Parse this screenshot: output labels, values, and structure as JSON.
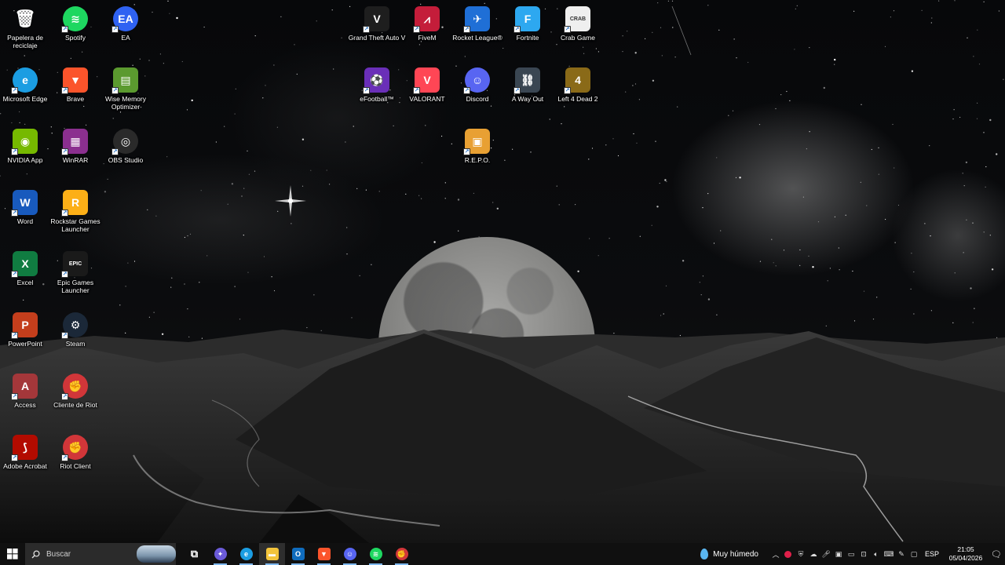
{
  "desktop": {
    "icons": [
      {
        "id": "recycle-bin",
        "label": "Papelera de reciclaje",
        "color": "#8ea3b5",
        "glyph": "🗑"
      },
      {
        "id": "spotify",
        "label": "Spotify",
        "color": "#1ed760",
        "glyph": "≋"
      },
      {
        "id": "ea",
        "label": "EA",
        "color": "#2f62f2",
        "glyph": "EA"
      },
      {
        "id": "microsoft-edge",
        "label": "Microsoft Edge",
        "color": "#1b9de2",
        "glyph": "e"
      },
      {
        "id": "brave",
        "label": "Brave",
        "color": "#fb542b",
        "glyph": "▼"
      },
      {
        "id": "wise-memory-optimizer",
        "label": "Wise Memory Optimizer",
        "color": "#5b9a2f",
        "glyph": "▤"
      },
      {
        "id": "nvidia-app",
        "label": "NVIDIA App",
        "color": "#76b900",
        "glyph": "◉"
      },
      {
        "id": "winrar",
        "label": "WinRAR",
        "color": "#8b2f8f",
        "glyph": "▦"
      },
      {
        "id": "obs-studio",
        "label": "OBS Studio",
        "color": "#2a2a2a",
        "glyph": "◎"
      },
      {
        "id": "word",
        "label": "Word",
        "color": "#185abd",
        "glyph": "W"
      },
      {
        "id": "rockstar-games-launcher",
        "label": "Rockstar Games Launcher",
        "color": "#fcaf17",
        "glyph": "R"
      },
      {
        "id": "excel",
        "label": "Excel",
        "color": "#107c41",
        "glyph": "X"
      },
      {
        "id": "epic-games-launcher",
        "label": "Epic Games Launcher",
        "color": "#1a1a1a",
        "glyph": "EPIC"
      },
      {
        "id": "powerpoint",
        "label": "PowerPoint",
        "color": "#c43e1c",
        "glyph": "P"
      },
      {
        "id": "steam",
        "label": "Steam",
        "color": "#1b2838",
        "glyph": "⚙"
      },
      {
        "id": "access",
        "label": "Access",
        "color": "#a4373a",
        "glyph": "A"
      },
      {
        "id": "cliente-de-riot",
        "label": "Cliente de Riot",
        "color": "#d13639",
        "glyph": "✊"
      },
      {
        "id": "adobe-acrobat",
        "label": "Adobe Acrobat",
        "color": "#b30b00",
        "glyph": "⟆"
      },
      {
        "id": "riot-client",
        "label": "Riot Client",
        "color": "#d13639",
        "glyph": "✊"
      },
      {
        "id": "gta-v",
        "label": "Grand Theft Auto V",
        "color": "#1e1e1e",
        "glyph": "V"
      },
      {
        "id": "fivem",
        "label": "FiveM",
        "color": "#c41d3a",
        "glyph": "⩘"
      },
      {
        "id": "rocket-league",
        "label": "Rocket League®",
        "color": "#1f6fd6",
        "glyph": "✈"
      },
      {
        "id": "fortnite",
        "label": "Fortnite",
        "color": "#2da8f0",
        "glyph": "F"
      },
      {
        "id": "crab-game",
        "label": "Crab Game",
        "color": "#efefef",
        "glyph": "CRAB"
      },
      {
        "id": "efootball",
        "label": "eFootball™",
        "color": "#6a2fb8",
        "glyph": "⚽"
      },
      {
        "id": "valorant",
        "label": "VALORANT",
        "color": "#ff4655",
        "glyph": "V"
      },
      {
        "id": "discord",
        "label": "Discord",
        "color": "#5865f2",
        "glyph": "☺"
      },
      {
        "id": "a-way-out",
        "label": "A Way Out",
        "color": "#3a4652",
        "glyph": "⛓"
      },
      {
        "id": "left-4-dead-2",
        "label": "Left 4 Dead 2",
        "color": "#8a6a18",
        "glyph": "4"
      },
      {
        "id": "repo",
        "label": "R.E.P.O.",
        "color": "#e8a033",
        "glyph": "▣"
      }
    ]
  },
  "taskbar": {
    "search_placeholder": "Buscar",
    "apps": [
      {
        "id": "task-view",
        "glyph": "⧉",
        "color": "#101010"
      },
      {
        "id": "copilot",
        "glyph": "✦",
        "color": "#6b5bd9"
      },
      {
        "id": "edge",
        "glyph": "e",
        "color": "#1b9de2"
      },
      {
        "id": "file-explorer",
        "glyph": "▬",
        "color": "#f3c43b"
      },
      {
        "id": "outlook",
        "glyph": "O",
        "color": "#0f6cbd"
      },
      {
        "id": "brave",
        "glyph": "▼",
        "color": "#fb542b"
      },
      {
        "id": "discord",
        "glyph": "☺",
        "color": "#5865f2"
      },
      {
        "id": "spotify",
        "glyph": "≋",
        "color": "#1ed760"
      },
      {
        "id": "riot",
        "glyph": "✊",
        "color": "#d13639"
      }
    ],
    "weather_text": "Muy húmedo",
    "language": "ESP",
    "time": "21:05",
    "date": "05/04/2026"
  }
}
